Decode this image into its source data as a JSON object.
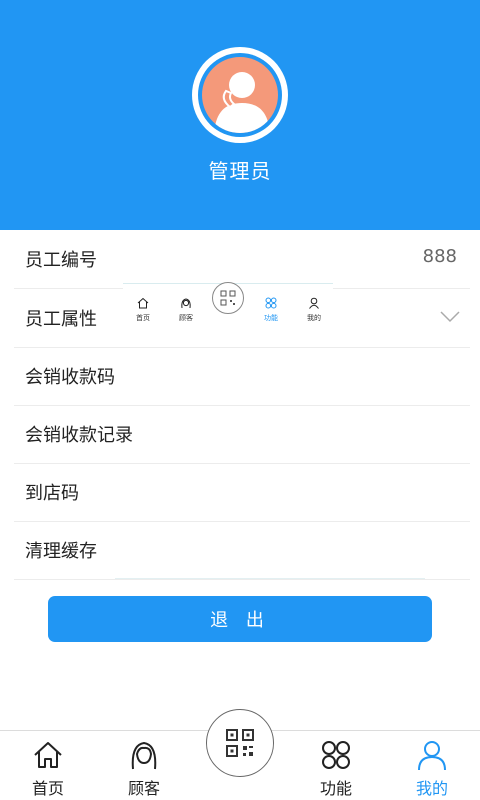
{
  "profile": {
    "name": "管理员"
  },
  "rows": [
    {
      "label": "员工编号",
      "value": "888"
    },
    {
      "label": "员工属性"
    },
    {
      "label": "会销收款码"
    },
    {
      "label": "会销收款记录"
    },
    {
      "label": "到店码"
    },
    {
      "label": "清理缓存"
    }
  ],
  "mini_tabbar": {
    "items": [
      {
        "label": "首页",
        "icon": "home-icon"
      },
      {
        "label": "顾客",
        "icon": "customer-icon"
      },
      {
        "label": "功能",
        "icon": "function-icon",
        "active": true
      },
      {
        "label": "我的",
        "icon": "user-icon"
      }
    ]
  },
  "logout_label": "退 出",
  "tabbar": {
    "items": [
      {
        "label": "首页",
        "icon": "home-icon"
      },
      {
        "label": "顾客",
        "icon": "customer-icon"
      },
      {
        "label": "功能",
        "icon": "function-icon"
      },
      {
        "label": "我的",
        "icon": "user-icon",
        "active": true
      }
    ],
    "center_icon": "qr-code-icon"
  },
  "colors": {
    "primary": "#2196f3",
    "avatar_bg": "#f4997a"
  }
}
